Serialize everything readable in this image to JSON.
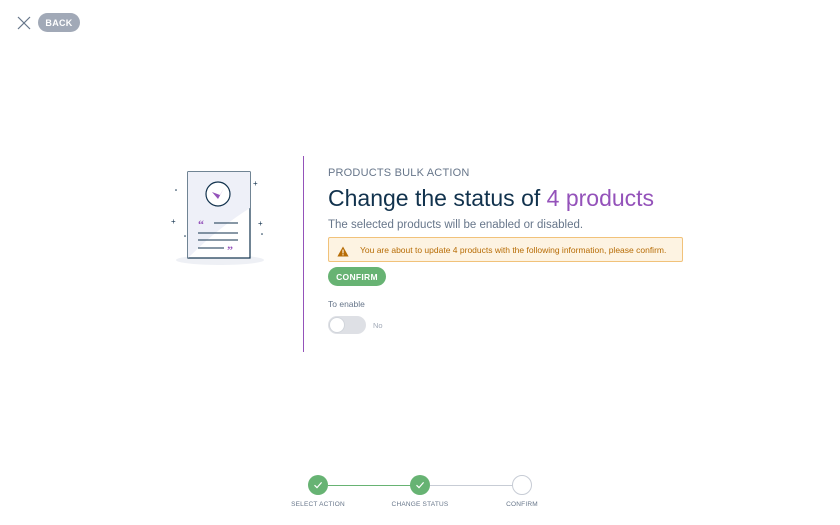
{
  "header": {
    "back_label": "BACK"
  },
  "main": {
    "subtitle": "PRODUCTS BULK ACTION",
    "title_prefix": "Change the status of ",
    "title_accent": "4 products",
    "description": "The selected products will be enabled or disabled.",
    "warning_text": "You are about to update 4 products with the following information, please confirm.",
    "confirm_label": "CONFIRM",
    "field_label": "To enable",
    "toggle_value": "No",
    "toggle_on": false
  },
  "stepper": {
    "steps": [
      {
        "label": "SELECT ACTION",
        "state": "done"
      },
      {
        "label": "CHANGE STATUS",
        "state": "done"
      },
      {
        "label": "CONFIRM",
        "state": "todo"
      }
    ]
  },
  "colors": {
    "accent": "#9452ba",
    "success": "#67b373",
    "warning_text": "#b76c05",
    "warning_bg": "#fdf3e2",
    "back_button": "#a1a9b7"
  },
  "icons": {
    "close": "close-icon",
    "warning": "warning-icon",
    "check": "check-icon",
    "illustration": "document-illustration"
  }
}
